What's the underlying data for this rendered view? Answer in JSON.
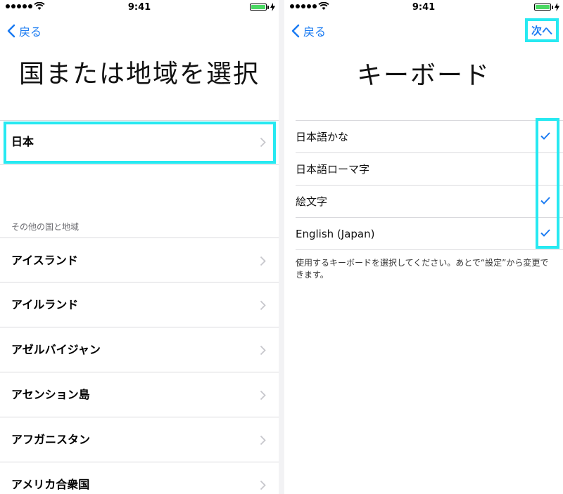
{
  "status_bar": {
    "time": "9:41"
  },
  "colors": {
    "accent": "#1a7bf2",
    "highlight": "#27e9f1",
    "battery": "#4cd964"
  },
  "left": {
    "back_label": "戻る",
    "title": "国または地域を選択",
    "selected_item": "日本",
    "section_header": "その他の国と地域",
    "items": [
      {
        "label": "アイスランド"
      },
      {
        "label": "アイルランド"
      },
      {
        "label": "アゼルバイジャン"
      },
      {
        "label": "アセンション島"
      },
      {
        "label": "アフガニスタン"
      },
      {
        "label": "アメリカ合衆国"
      }
    ]
  },
  "right": {
    "back_label": "戻る",
    "next_label": "次へ",
    "title": "キーボード",
    "keyboards": [
      {
        "label": "日本語かな",
        "checked": true,
        "check_icon": "checkmark-icon"
      },
      {
        "label": "日本語ローマ字",
        "checked": false
      },
      {
        "label": "絵文字",
        "checked": true,
        "check_icon": "checkmark-icon"
      },
      {
        "label": "English (Japan)",
        "checked": true,
        "check_icon": "checkmark-icon"
      }
    ],
    "footnote": "使用するキーボードを選択してください。あとで“設定”から変更できます。"
  }
}
